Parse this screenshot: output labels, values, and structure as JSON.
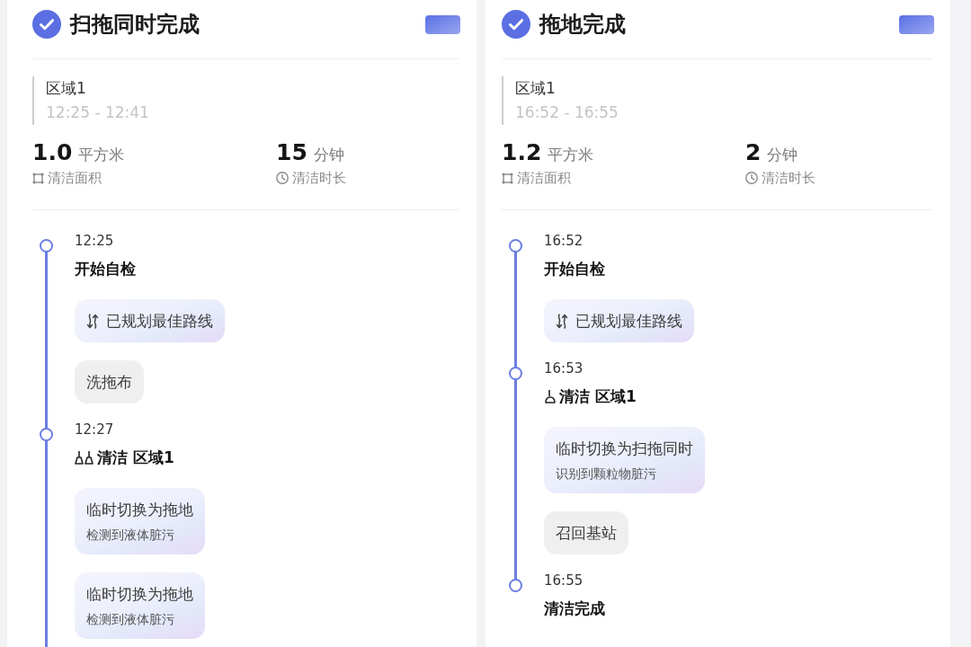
{
  "cards": [
    {
      "title": "扫拖同时完成",
      "zone": {
        "name": "区域1",
        "time_range": "12:25 - 12:41"
      },
      "stats": [
        {
          "kind": "area",
          "value": "1.0",
          "unit": "平方米",
          "label": "清洁面积"
        },
        {
          "kind": "duration",
          "value": "15",
          "unit": "分钟",
          "label": "清洁时长"
        }
      ],
      "timeline": {
        "continues": true,
        "events": [
          {
            "time": "12:25",
            "title": "开始自检",
            "kind": "plain",
            "chips": [
              {
                "kind": "route",
                "text": "已规划最佳路线"
              },
              {
                "kind": "action",
                "text": "洗拖布"
              }
            ]
          },
          {
            "time": "12:27",
            "title": "清洁 区域1",
            "kind": "sweep-mop",
            "chips": [
              {
                "kind": "switch",
                "text": "临时切换为拖地",
                "note": "检测到液体脏污"
              },
              {
                "kind": "switch",
                "text": "临时切换为拖地",
                "note": "检测到液体脏污"
              }
            ]
          }
        ]
      }
    },
    {
      "title": "拖地完成",
      "zone": {
        "name": "区域1",
        "time_range": "16:52 - 16:55"
      },
      "stats": [
        {
          "kind": "area",
          "value": "1.2",
          "unit": "平方米",
          "label": "清洁面积"
        },
        {
          "kind": "duration",
          "value": "2",
          "unit": "分钟",
          "label": "清洁时长"
        }
      ],
      "timeline": {
        "continues": false,
        "events": [
          {
            "time": "16:52",
            "title": "开始自检",
            "kind": "plain",
            "chips": [
              {
                "kind": "route",
                "text": "已规划最佳路线"
              }
            ]
          },
          {
            "time": "16:53",
            "title": "清洁 区域1",
            "kind": "mop",
            "chips": [
              {
                "kind": "switch",
                "text": "临时切换为扫拖同时",
                "note": "识别到颗粒物脏污"
              },
              {
                "kind": "action",
                "text": "召回基站"
              }
            ]
          },
          {
            "time": "16:55",
            "title": "清洁完成",
            "kind": "plain"
          }
        ]
      }
    }
  ]
}
